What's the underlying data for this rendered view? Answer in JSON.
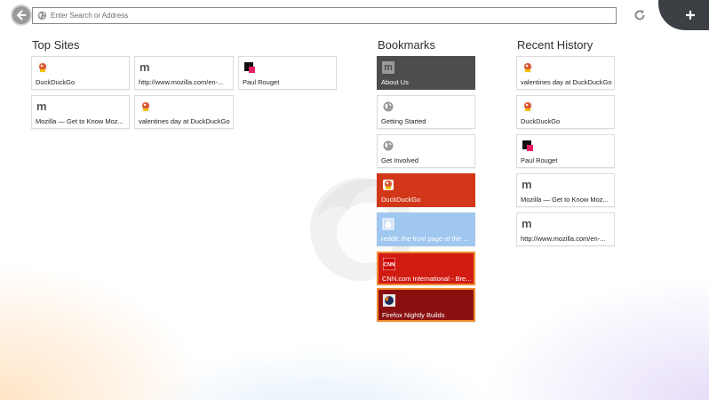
{
  "toolbar": {
    "search_placeholder": "Enter Search or Address"
  },
  "top_sites": {
    "title": "Top Sites",
    "items": [
      {
        "label": "DuckDuckGo",
        "icon": "duckduckgo-icon"
      },
      {
        "label": "http://www.mozilla.com/en-...",
        "icon": "mozilla-m-icon"
      },
      {
        "label": "Paul Rouget",
        "icon": "paulrouget-icon"
      },
      {
        "label": "Mozilla — Get to Know Moz...",
        "icon": "mozilla-m-icon"
      },
      {
        "label": "valentines day at DuckDuckGo",
        "icon": "duckduckgo-icon"
      }
    ]
  },
  "bookmarks": {
    "title": "Bookmarks",
    "items": [
      {
        "label": "About Us",
        "icon": "mozilla-m-icon"
      },
      {
        "label": "Getting Started",
        "icon": "globe-icon"
      },
      {
        "label": "Get Involved",
        "icon": "globe-icon"
      },
      {
        "label": "DuckDuckGo",
        "icon": "duckduckgo-icon"
      },
      {
        "label": "reddit: the front page of the ...",
        "icon": "reddit-icon"
      },
      {
        "label": "CNN.com International - Bre...",
        "icon": "cnn-icon"
      },
      {
        "label": "Firefox Nightly Builds",
        "icon": "firefox-nightly-icon"
      }
    ]
  },
  "recent_history": {
    "title": "Recent History",
    "items": [
      {
        "label": "valentines day at DuckDuckGo",
        "icon": "duckduckgo-icon"
      },
      {
        "label": "DuckDuckGo",
        "icon": "duckduckgo-icon"
      },
      {
        "label": "Paul Rouget",
        "icon": "paulrouget-icon"
      },
      {
        "label": "Mozilla — Get to Know Moz...",
        "icon": "mozilla-m-icon"
      },
      {
        "label": "http://www.mozilla.com/en-...",
        "icon": "mozilla-m-icon"
      }
    ]
  },
  "colors": {
    "bookmark_dark": "#4d4d4f",
    "bookmark_red": "#d2371a",
    "bookmark_blue": "#9fc7ef",
    "bookmark_cnn": "#d01c13",
    "bookmark_nightly": "#8a1010",
    "highlight_border": "#f08a2e"
  }
}
